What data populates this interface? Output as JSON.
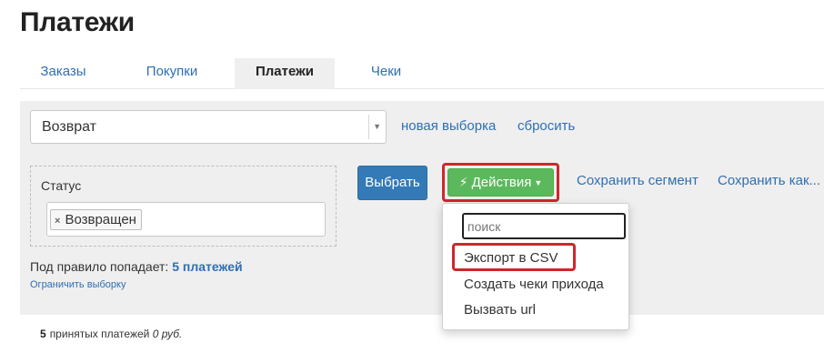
{
  "page": {
    "title": "Платежи"
  },
  "tabs": [
    {
      "label": "Заказы"
    },
    {
      "label": "Покупки"
    },
    {
      "label": "Платежи"
    },
    {
      "label": "Чеки"
    }
  ],
  "filter": {
    "segment_value": "Возврат",
    "new_selection_link": "новая выборка",
    "reset_link": "сбросить",
    "rule": {
      "label": "Статус",
      "tag": "Возвращен",
      "tag_remove_symbol": "×"
    },
    "select_button": "Выбрать",
    "actions_button": "Действия",
    "save_segment_link": "Сохранить сегмент",
    "save_as_link": "Сохранить как...",
    "hint_prefix": "Под правило попадает:",
    "hint_count": "5 платежей",
    "limit_link": "Ограничить выборку"
  },
  "actions_menu": {
    "search_placeholder": "поиск",
    "items": [
      {
        "label": "Экспорт в CSV"
      },
      {
        "label": "Создать чеки прихода"
      },
      {
        "label": "Вызвать url"
      }
    ]
  },
  "summary": {
    "count": "5",
    "text": "принятых платежей",
    "amount": "0 руб."
  },
  "colors": {
    "primary_button": "#337ab7",
    "success_button": "#5cb85c",
    "link": "#2f6fb2",
    "highlight": "#d0262c",
    "panel_bg": "#efefef"
  },
  "icons": [
    "bolt-icon",
    "caret-down-icon",
    "remove-tag-icon",
    "select-arrow-icon"
  ]
}
